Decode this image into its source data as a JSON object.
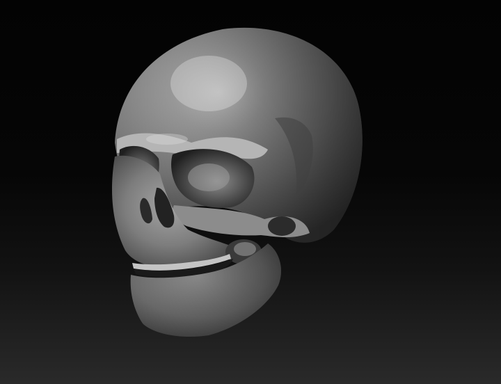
{
  "scene": {
    "subject_icon": "skull-sculpt-icon",
    "background_top_color": "#030303",
    "background_bottom_color": "#2a2a2a",
    "material_base_color": "#8a8a8a",
    "material_highlight_color": "#d8d8d8",
    "material_shadow_color": "#262626"
  }
}
